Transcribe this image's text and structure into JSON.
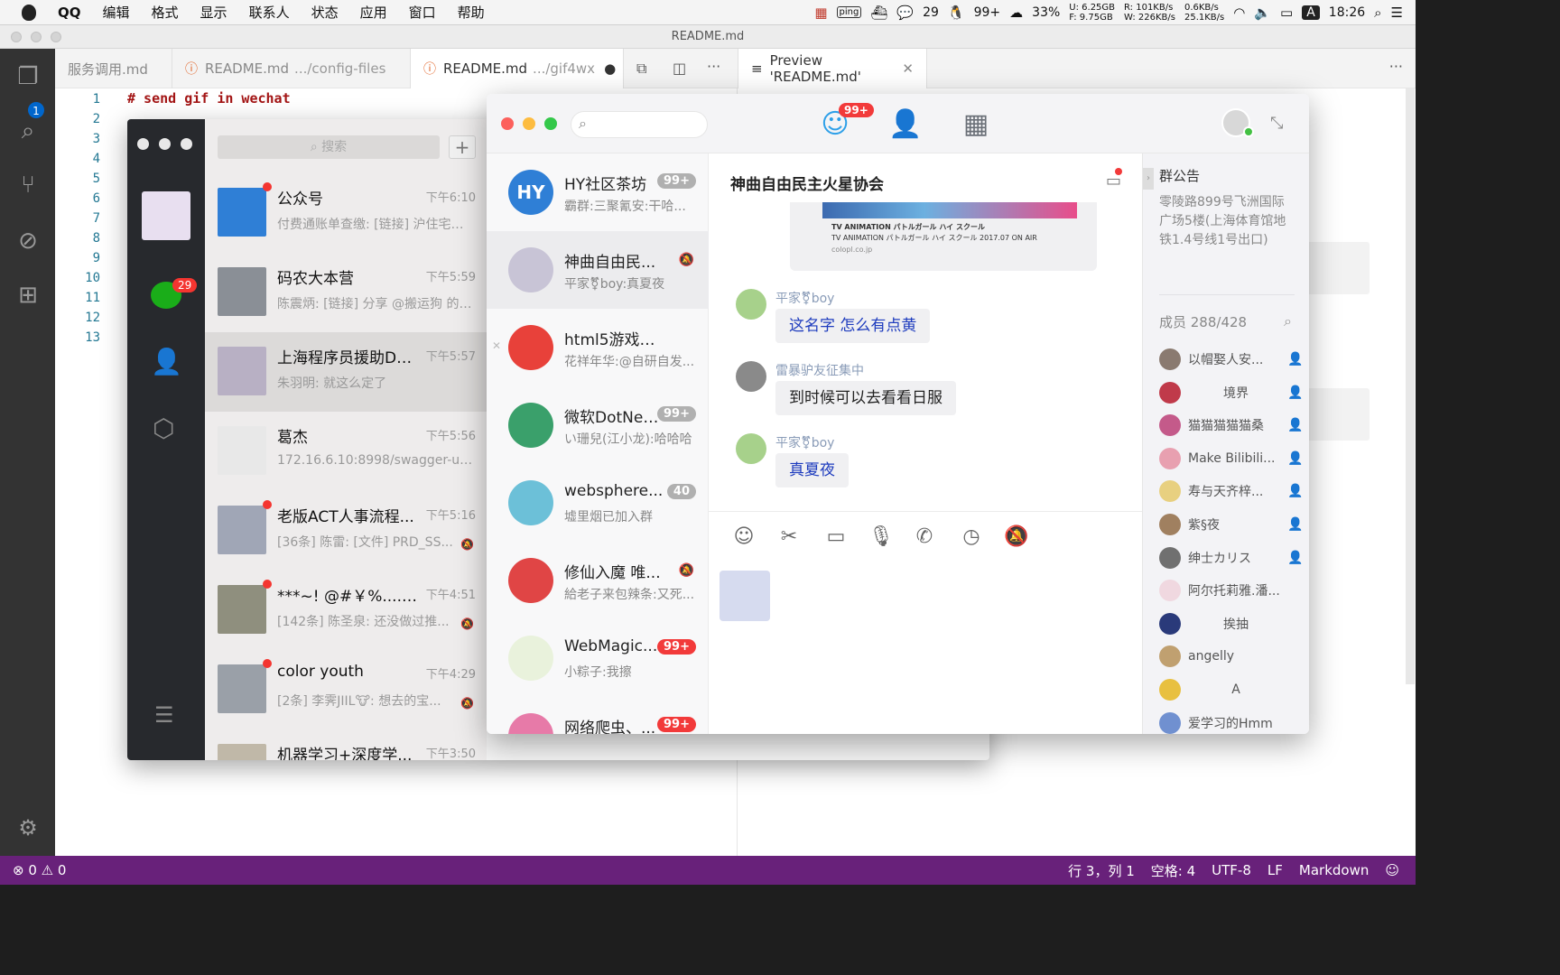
{
  "menubar": {
    "app": "QQ",
    "menus": [
      "编辑",
      "格式",
      "显示",
      "联系人",
      "状态",
      "应用",
      "窗口",
      "帮助"
    ],
    "qq_count": "29",
    "qq_status": "99+",
    "battery": "33%",
    "mem_used": "U: 6.25GB",
    "mem_free": "F: 9.75GB",
    "net_r": "R: 101KB/s",
    "net_w": "W: 226KB/s",
    "up": "0.6KB/s",
    "down": "25.1KB/s",
    "input_method": "A",
    "clock": "18:26"
  },
  "vscode": {
    "window_title": "README.md",
    "explorer_badge": "1",
    "tabs": [
      {
        "label": "服务调用.md",
        "dim": ""
      },
      {
        "label": "README.md",
        "dim": ".../config-files"
      },
      {
        "label": "README.md",
        "dim": ".../gif4wx"
      },
      {
        "label": "Preview 'README.md'",
        "dim": ""
      }
    ],
    "code_line_1": "# send gif in wechat",
    "line_numbers": [
      "1",
      "2",
      "3",
      "4",
      "5",
      "6",
      "7",
      "8",
      "9",
      "10",
      "11",
      "12",
      "13"
    ],
    "status": {
      "errors": "0",
      "warnings": "0",
      "position": "行 3，列 1",
      "spaces": "空格: 4",
      "encoding": "UTF-8",
      "eol": "LF",
      "language": "Markdown"
    }
  },
  "wechat": {
    "chat_badge": "29",
    "search_placeholder": "搜索",
    "chats": [
      {
        "name": "公众号",
        "time": "下午6:10",
        "msg": "付费通账单查缴: [链接] 沪住宅物业费...",
        "reddot": true
      },
      {
        "name": "码农大本营",
        "time": "下午5:59",
        "msg": "陈震炳: [链接] 分享 @搬运狗 的微博...",
        "reddot": false
      },
      {
        "name": "上海程序员援助DE...",
        "time": "下午5:57",
        "msg": "朱羽明: 就这么定了",
        "reddot": false
      },
      {
        "name": "葛杰",
        "time": "下午5:56",
        "msg": "172.16.6.10:8998/swagger-ui....",
        "reddot": false
      },
      {
        "name": "老版ACT人事流程...",
        "time": "下午5:16",
        "msg": "[36条] 陈雷: [文件] PRD_SS...",
        "reddot": true
      },
      {
        "name": "***~! @#￥%........",
        "time": "下午4:51",
        "msg": "[142条] 陈圣泉: 还没做过推...",
        "reddot": true
      },
      {
        "name": "color youth",
        "time": "下午4:29",
        "msg": "[2条] 李霁JIIL🐮: 想去的宝...",
        "reddot": true
      },
      {
        "name": "机器学习+深度学...",
        "time": "下午3:50",
        "msg": "",
        "reddot": false
      }
    ]
  },
  "qq": {
    "nav_badge": "99+",
    "conversations": [
      {
        "name": "HY社区茶坊",
        "msg": "霸群:三聚氰安:干哈...",
        "count": "99+",
        "count_color": "#b0b0b0",
        "avatar_text": "HY",
        "avatar_color": "#2f7fd6"
      },
      {
        "name": "神曲自由民...",
        "msg": "平家⚧boy:真夏夜",
        "count": "",
        "count_color": "",
        "avatar_text": "",
        "avatar_color": "#c8c4d6"
      },
      {
        "name": "html5游戏行业...",
        "msg": "花祥年华:@自研自发...",
        "count": "",
        "count_color": "",
        "avatar_text": "",
        "avatar_color": "#e8413a"
      },
      {
        "name": "微软DotNet...",
        "msg": "い珊兒(江小龙):哈哈哈",
        "count": "99+",
        "count_color": "#b0b0b0",
        "avatar_text": "",
        "avatar_color": "#3aa06b"
      },
      {
        "name": "websphere...",
        "msg": "墟里烟已加入群",
        "count": "40",
        "count_color": "#b0b0b0",
        "avatar_text": "",
        "avatar_color": "#6cc0d8"
      },
      {
        "name": "修仙入魔 唯...",
        "msg": "給老子来包辣条:又死...",
        "count": "",
        "count_color": "",
        "avatar_text": "",
        "avatar_color": "#e04545"
      },
      {
        "name": "WebMagic...",
        "msg": "小粽子:我擦",
        "count": "99+",
        "count_color": "#f23a3a",
        "avatar_text": "",
        "avatar_color": "#e9f2dc"
      },
      {
        "name": "网络爬虫、...",
        "msg": "",
        "count": "99+",
        "count_color": "#f23a3a",
        "avatar_text": "",
        "avatar_color": "#e77aa8"
      }
    ],
    "chat": {
      "title": "神曲自由民主火星协会",
      "card_line1": "TV ANIMATION パトルガール ハイ スクール",
      "card_line2": "TV ANIMATION パトルガール ハイ スクール 2017.07 ON AIR",
      "card_line3": "colopl.co.jp",
      "messages": [
        {
          "sender": "平家⚧boy",
          "text": "这名字 怎么有点黄",
          "style": "blue"
        },
        {
          "sender": "雷暴驴友征集中",
          "text": "到时候可以去看看日服",
          "style": "dark"
        },
        {
          "sender": "平家⚧boy",
          "text": "真夏夜",
          "style": "blue"
        }
      ]
    },
    "panel": {
      "announcement_title": "群公告",
      "announcement": "零陵路899号飞洲国际广场5楼(上海体育馆地铁1.4号线1号出口)",
      "members_title": "成员 288/428",
      "members": [
        "以帽娶人安...",
        "境界",
        "猫猫猫猫猫桑",
        "Make Bilibili...",
        "寿与天齐梓...",
        "紫§夜",
        "绅士カリス",
        "阿尔托莉雅.潘...",
        "挨抽",
        "angelly",
        "A",
        "爱学习的Hmm"
      ]
    }
  }
}
